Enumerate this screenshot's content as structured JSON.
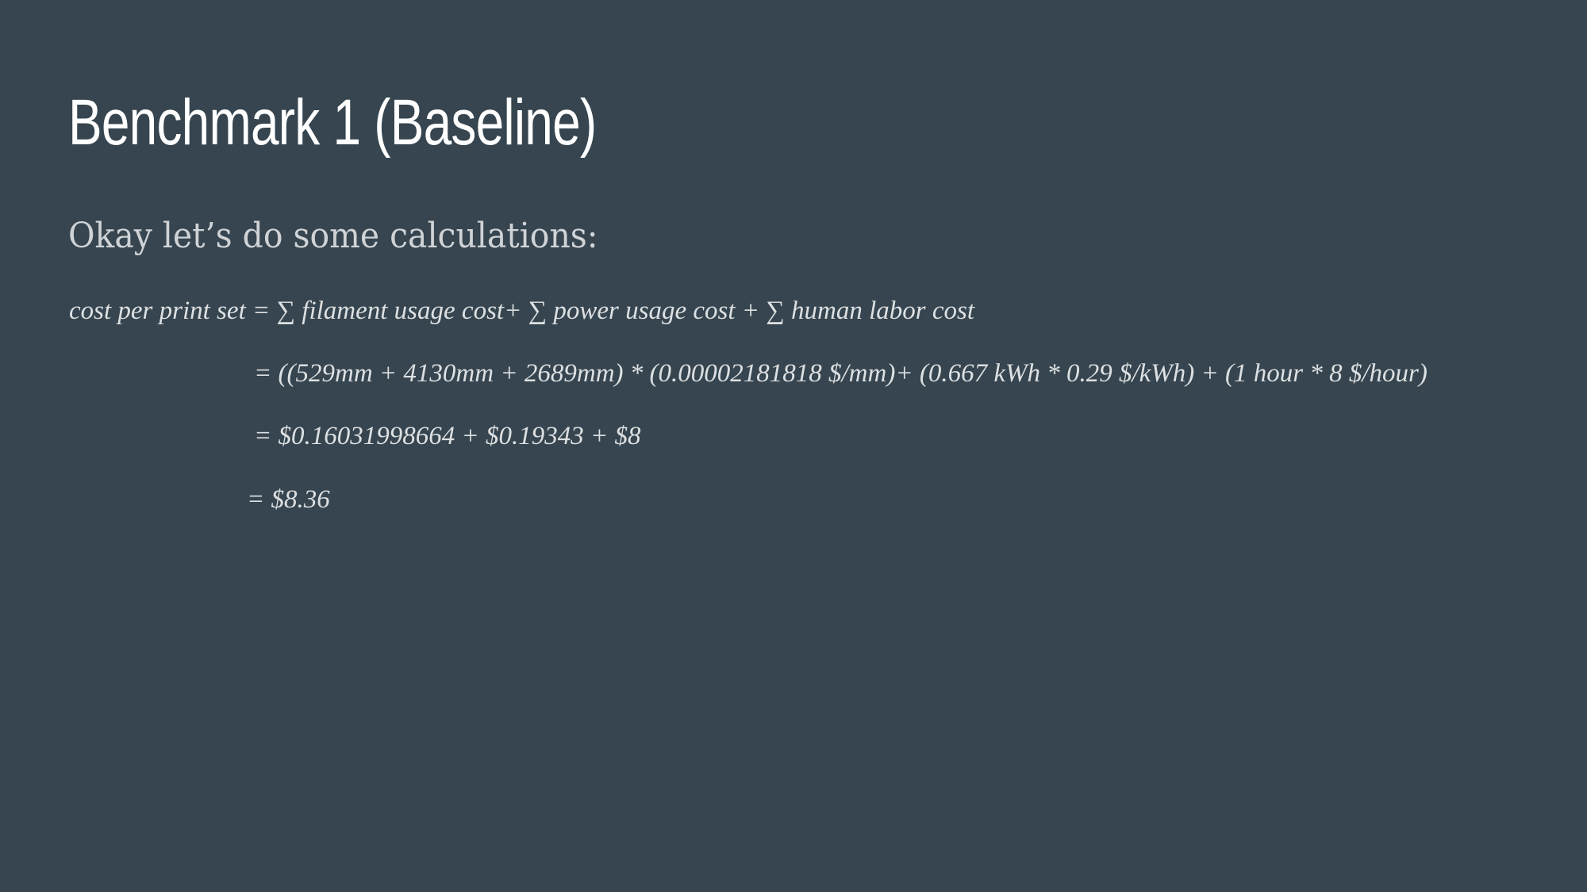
{
  "slide": {
    "title": "Benchmark 1 (Baseline)",
    "subtitle": "Okay let’s do some calculations:",
    "formula_lines": [
      "cost per print set = ∑ filament usage cost+ ∑ power usage cost + ∑ human labor cost",
      "= ((529mm + 4130mm + 2689mm) * (0.00002181818 $/mm)+ (0.667 kWh * 0.29 $/kWh) + (1 hour * 8 $/hour)",
      "=  $0.16031998664 + $0.19343 + $8",
      "= $8.36"
    ]
  }
}
